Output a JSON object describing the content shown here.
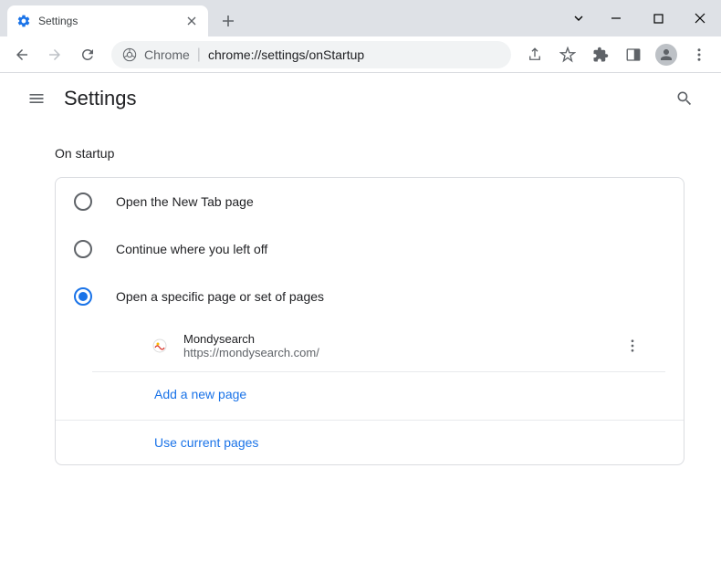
{
  "window": {
    "tab_title": "Settings"
  },
  "omnibox": {
    "origin": "Chrome",
    "path": "chrome://settings/onStartup"
  },
  "header": {
    "title": "Settings"
  },
  "section": {
    "title": "On startup",
    "options": [
      {
        "label": "Open the New Tab page"
      },
      {
        "label": "Continue where you left off"
      },
      {
        "label": "Open a specific page or set of pages"
      }
    ],
    "pages": [
      {
        "name": "Mondysearch",
        "url": "https://mondysearch.com/"
      }
    ],
    "add_page": "Add a new page",
    "use_current": "Use current pages"
  }
}
